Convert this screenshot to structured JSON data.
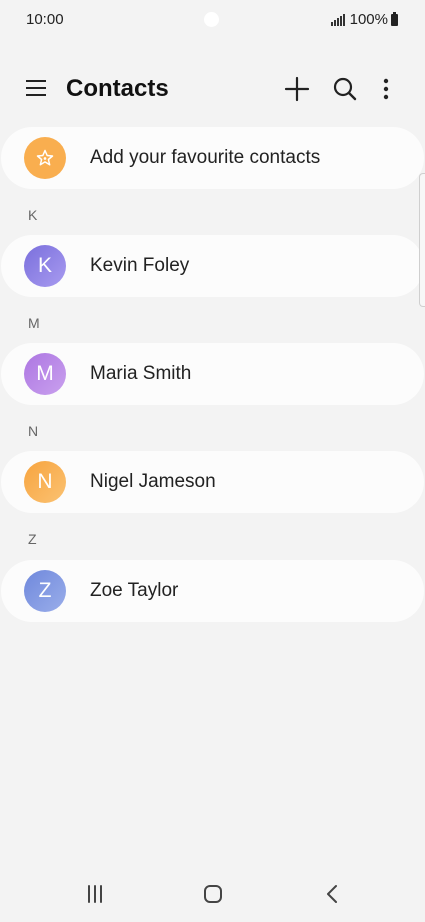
{
  "status_bar": {
    "time": "10:00",
    "battery": "100%"
  },
  "header": {
    "title": "Contacts"
  },
  "favourites": {
    "label": "Add your favourite contacts",
    "icon": "star-icon",
    "avatar_color": "#f9ae4f"
  },
  "sections": [
    {
      "letter": "K",
      "contact": {
        "name": "Kevin Foley",
        "initial": "K",
        "color": "#8a7de0"
      }
    },
    {
      "letter": "M",
      "contact": {
        "name": "Maria Smith",
        "initial": "M",
        "color": "#b986e6"
      }
    },
    {
      "letter": "N",
      "contact": {
        "name": "Nigel Jameson",
        "initial": "N",
        "color": "#f9ae4f"
      }
    },
    {
      "letter": "Z",
      "contact": {
        "name": "Zoe Taylor",
        "initial": "Z",
        "color": "#7f97e0"
      }
    }
  ]
}
